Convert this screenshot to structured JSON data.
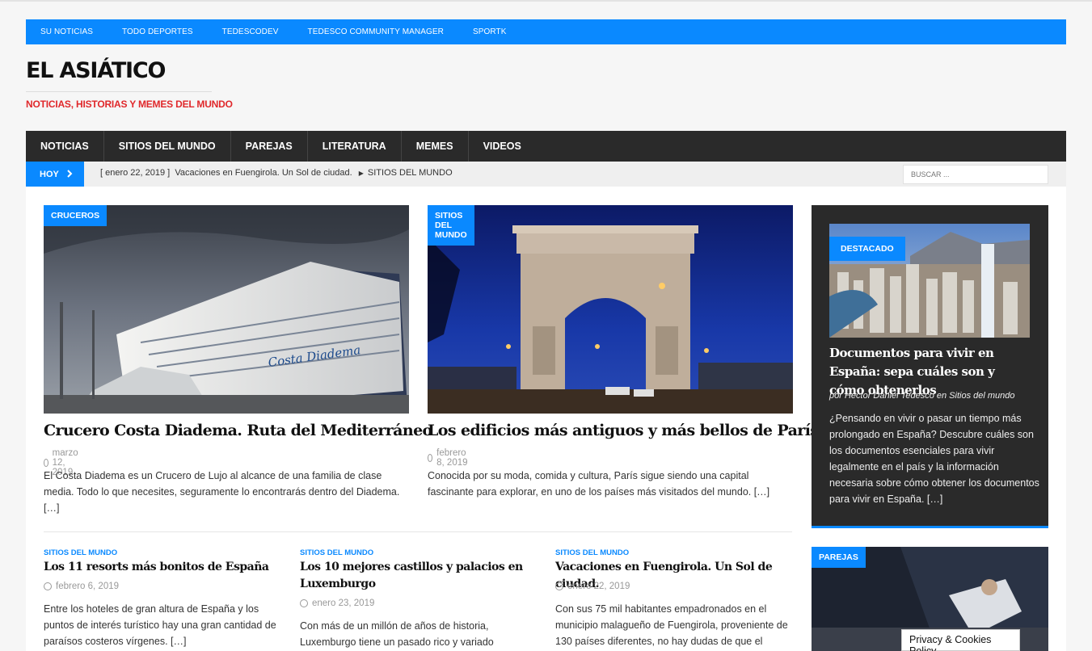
{
  "top_bar": {
    "items": [
      "SU NOTICIAS",
      "TODO DEPORTES",
      "TEDESCODEV",
      "TEDESCO COMMUNITY MANAGER",
      "SPORTK"
    ]
  },
  "site": {
    "title": "EL ASIÁTICO",
    "tagline": "NOTICIAS, HISTORIAS Y MEMES DEL MUNDO"
  },
  "main_nav": {
    "items": [
      "NOTICIAS",
      "SITIOS DEL MUNDO",
      "PAREJAS",
      "LITERATURA",
      "MEMES",
      "VIDEOS"
    ]
  },
  "ticker": {
    "label": "HOY",
    "date": "[ enero 22, 2019 ]",
    "headline": "Vacaciones en Fuengirola. Un Sol de ciudad.",
    "category": "SITIOS DEL MUNDO"
  },
  "search": {
    "placeholder": "BUSCAR ..."
  },
  "featured": [
    {
      "category": "CRUCEROS",
      "title": "Crucero Costa Diadema. Ruta del Mediterráneo",
      "date": "marzo 12, 2019",
      "excerpt": "El Costa Diadema es un Crucero de Lujo al alcance de una familia de clase media. Todo lo que necesites, seguramente lo encontrarás dentro del Diadema. […]",
      "ship_name": "Costa Diadema"
    },
    {
      "category": "SITIOS DEL MUNDO",
      "title": "Los edificios más antiguos y más bellos de París",
      "date": "febrero 8, 2019",
      "excerpt": "Conocida por su moda, comida y cultura, París sigue siendo una capital fascinante para explorar, en uno de los países más visitados del mundo. […]"
    }
  ],
  "small_posts": [
    {
      "category": "SITIOS DEL MUNDO",
      "title": "Los 11 resorts más bonitos de España",
      "date": "febrero 6, 2019",
      "excerpt": "Entre los hoteles de gran altura de España y los puntos de interés turístico hay una gran cantidad de paraísos costeros vírgenes. […]"
    },
    {
      "category": "SITIOS DEL MUNDO",
      "title": "Los 10 mejores castillos y palacios en Luxemburgo",
      "date": "enero 23, 2019",
      "excerpt": "Con más de un millón de años de historia, Luxemburgo tiene un pasado rico y variado"
    },
    {
      "category": "SITIOS DEL MUNDO",
      "title": "Vacaciones en Fuengirola. Un Sol de ciudad.",
      "date": "enero 22, 2019",
      "excerpt": "Con sus 75 mil habitantes empadronados en el municipio malagueño de Fuengirola, proveniente de 130 países diferentes, no hay dudas de que el"
    }
  ],
  "sidebar": {
    "featured_label": "DESTACADO",
    "title": "Documentos para vivir en España: sepa cuáles son y cómo obtenerlos",
    "byline": "por Hector Daniel Tedesco en Sitios del mundo",
    "excerpt": "¿Pensando en vivir o pasar un tiempo más prolongado en España? Descubre cuáles son los documentos esenciales para vivir legalmente en el país y la información necesaria sobre cómo obtener los documentos para vivir en España. […]",
    "second_label": "PAREJAS"
  },
  "cookie": {
    "label": "Privacy & Cookies Policy"
  },
  "colors": {
    "accent": "#0a89ff",
    "nav": "#2a2a2a",
    "tagline": "#e0282b"
  },
  "icons": [
    "chevron-right-icon",
    "clock-icon",
    "triangle-right-icon"
  ]
}
